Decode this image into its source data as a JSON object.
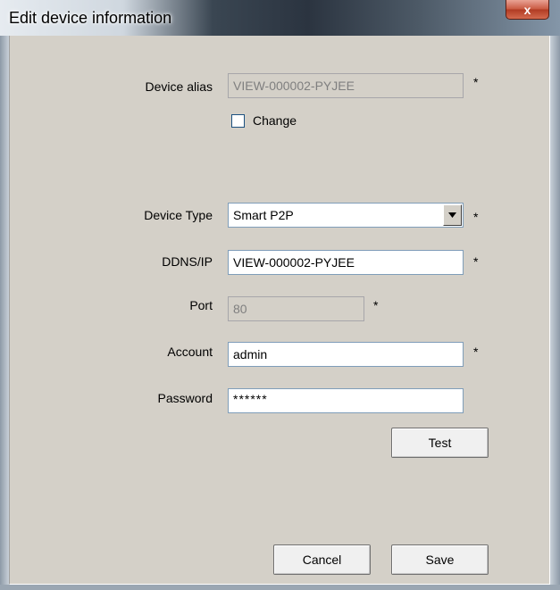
{
  "window": {
    "title": "Edit device information",
    "close_glyph": "x"
  },
  "form": {
    "device_alias": {
      "label": "Device alias",
      "value": "VIEW-000002-PYJEE",
      "required": "*",
      "disabled": true
    },
    "change": {
      "label": "Change",
      "checked": false
    },
    "device_type": {
      "label": "Device Type",
      "value": "Smart P2P",
      "required": "*"
    },
    "ddns_ip": {
      "label": "DDNS/IP",
      "value": "VIEW-000002-PYJEE",
      "required": "*"
    },
    "port": {
      "label": "Port",
      "value": "80",
      "required": "*",
      "disabled": true
    },
    "account": {
      "label": "Account",
      "value": "admin",
      "required": "*"
    },
    "password": {
      "label": "Password",
      "value": "******"
    }
  },
  "buttons": {
    "test": "Test",
    "cancel": "Cancel",
    "save": "Save"
  },
  "icons": {
    "close": "close-icon",
    "dropdown": "chevron-down-icon"
  }
}
